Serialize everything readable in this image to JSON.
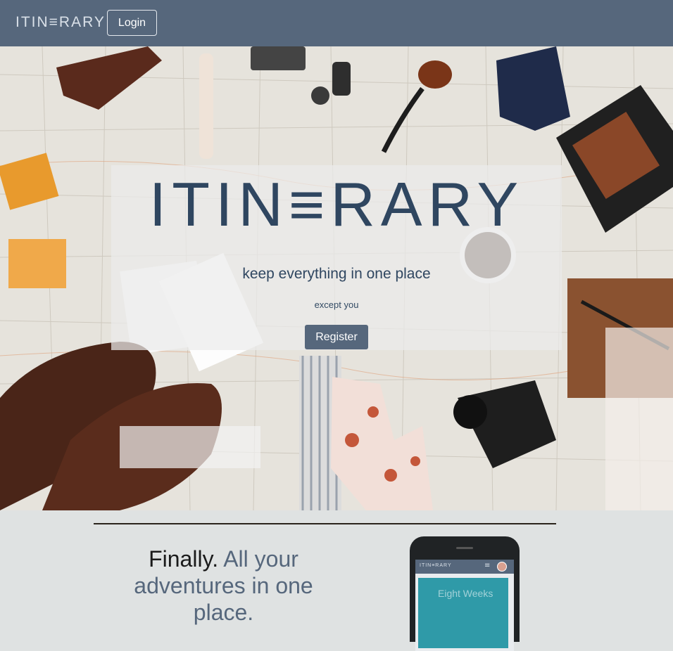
{
  "navbar": {
    "brand": "ITIN≡RARY",
    "login_label": "Login",
    "bg_color": "#56677c"
  },
  "hero": {
    "logo_text": "ITIN≡RARY",
    "tagline": "keep everything in one place",
    "subtagline": "except you",
    "register_label": "Register"
  },
  "feature": {
    "headline_dark": "Finally.",
    "headline_muted": "All your adventures in one place.",
    "phone": {
      "brand": "ITIN≡RARY",
      "menu_icon": "≡",
      "title": "Eight Weeks"
    }
  },
  "colors": {
    "accent": "#56677c",
    "logo": "#2f4660",
    "page_bg": "#dfe2e2"
  }
}
